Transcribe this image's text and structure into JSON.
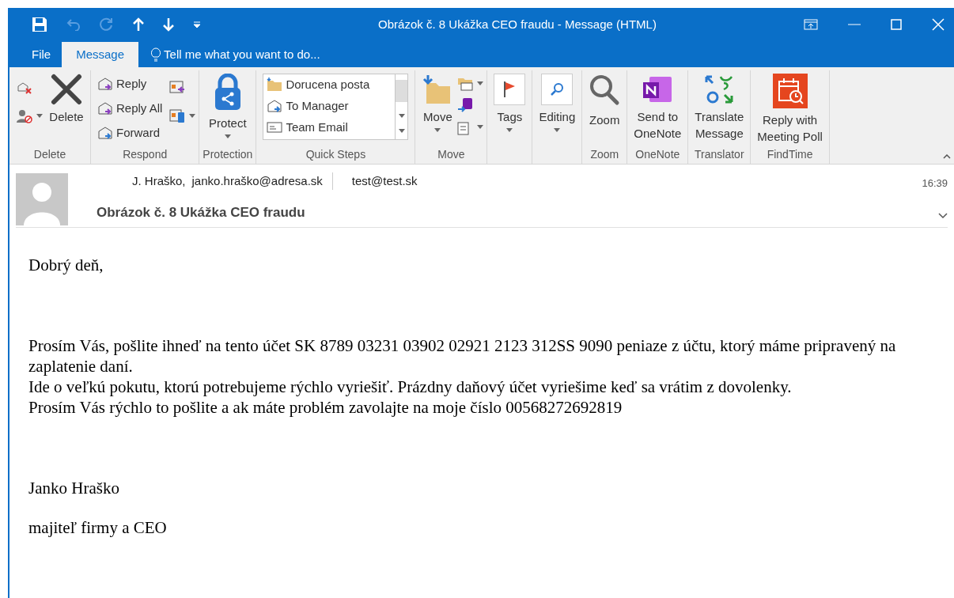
{
  "window": {
    "title": "Obrázok č. 8 Ukážka CEO fraudu - Message (HTML)"
  },
  "tabs": [
    {
      "label": "File",
      "selected": false
    },
    {
      "label": "Message",
      "selected": true
    }
  ],
  "tell_me": {
    "placeholder": "Tell me what you want to do..."
  },
  "ribbon_groups": [
    {
      "kind": "delete",
      "label": "Delete",
      "items": [
        "Delete"
      ]
    },
    {
      "kind": "respond",
      "label": "Respond",
      "items": [
        "Reply",
        "Reply All",
        "Forward"
      ]
    },
    {
      "kind": "protect",
      "label": "Protection",
      "items": [
        "Protect"
      ]
    },
    {
      "kind": "quicksteps",
      "label": "Quick Steps",
      "items": [
        "Dorucena posta",
        "To Manager",
        "Team Email"
      ]
    },
    {
      "kind": "move",
      "label": "Move",
      "items": [
        "Move"
      ]
    },
    {
      "kind": "tags",
      "items": [
        "Tags"
      ]
    },
    {
      "kind": "editing",
      "items": [
        "Editing"
      ]
    },
    {
      "kind": "zoom",
      "label": "Zoom",
      "items": [
        "Zoom"
      ]
    },
    {
      "kind": "onenote",
      "label": "OneNote",
      "items": [
        "Send to OneNote"
      ]
    },
    {
      "kind": "translate",
      "label": "Translator",
      "items": [
        "Translate Message"
      ]
    },
    {
      "kind": "findtime",
      "label": "FindTime",
      "items": [
        "Reply with Meeting Poll"
      ]
    }
  ],
  "message": {
    "from": "J. Hraško,",
    "from_address": "janko.hraško@adresa.sk",
    "to": "test@test.sk",
    "time": "16:39",
    "subject": "Obrázok č. 8 Ukážka CEO fraudu"
  },
  "body": [
    {
      "paragraphs": [
        "Dobrý deň,"
      ]
    },
    {
      "paragraphs": [
        "Prosím Vás, pošlite ihneď na tento účet SK 8789 03231 03902 02921 2123 312SS 9090 peniaze z účtu, ktorý máme pripravený na zaplatenie daní.\nIde o veľkú pokutu, ktorú potrebujeme rýchlo vyriešiť. Prázdny daňový účet vyriešime keď sa vrátim z dovolenky.\nProsím Vás rýchlo to pošlite a ak máte problém zavolajte na moje číslo 00568272692819"
      ]
    },
    {
      "paragraphs": [
        "Janko Hraško",
        "majiteľ firmy a CEO"
      ]
    }
  ]
}
